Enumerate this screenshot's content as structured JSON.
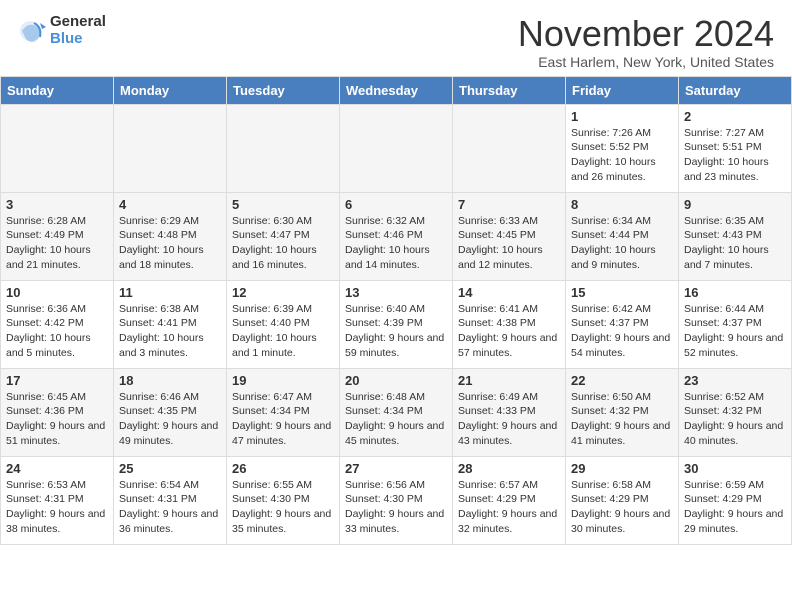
{
  "logo": {
    "general": "General",
    "blue": "Blue"
  },
  "title": "November 2024",
  "location": "East Harlem, New York, United States",
  "weekdays": [
    "Sunday",
    "Monday",
    "Tuesday",
    "Wednesday",
    "Thursday",
    "Friday",
    "Saturday"
  ],
  "weeks": [
    [
      {
        "day": "",
        "info": ""
      },
      {
        "day": "",
        "info": ""
      },
      {
        "day": "",
        "info": ""
      },
      {
        "day": "",
        "info": ""
      },
      {
        "day": "",
        "info": ""
      },
      {
        "day": "1",
        "info": "Sunrise: 7:26 AM\nSunset: 5:52 PM\nDaylight: 10 hours and 26 minutes."
      },
      {
        "day": "2",
        "info": "Sunrise: 7:27 AM\nSunset: 5:51 PM\nDaylight: 10 hours and 23 minutes."
      }
    ],
    [
      {
        "day": "3",
        "info": "Sunrise: 6:28 AM\nSunset: 4:49 PM\nDaylight: 10 hours and 21 minutes."
      },
      {
        "day": "4",
        "info": "Sunrise: 6:29 AM\nSunset: 4:48 PM\nDaylight: 10 hours and 18 minutes."
      },
      {
        "day": "5",
        "info": "Sunrise: 6:30 AM\nSunset: 4:47 PM\nDaylight: 10 hours and 16 minutes."
      },
      {
        "day": "6",
        "info": "Sunrise: 6:32 AM\nSunset: 4:46 PM\nDaylight: 10 hours and 14 minutes."
      },
      {
        "day": "7",
        "info": "Sunrise: 6:33 AM\nSunset: 4:45 PM\nDaylight: 10 hours and 12 minutes."
      },
      {
        "day": "8",
        "info": "Sunrise: 6:34 AM\nSunset: 4:44 PM\nDaylight: 10 hours and 9 minutes."
      },
      {
        "day": "9",
        "info": "Sunrise: 6:35 AM\nSunset: 4:43 PM\nDaylight: 10 hours and 7 minutes."
      }
    ],
    [
      {
        "day": "10",
        "info": "Sunrise: 6:36 AM\nSunset: 4:42 PM\nDaylight: 10 hours and 5 minutes."
      },
      {
        "day": "11",
        "info": "Sunrise: 6:38 AM\nSunset: 4:41 PM\nDaylight: 10 hours and 3 minutes."
      },
      {
        "day": "12",
        "info": "Sunrise: 6:39 AM\nSunset: 4:40 PM\nDaylight: 10 hours and 1 minute."
      },
      {
        "day": "13",
        "info": "Sunrise: 6:40 AM\nSunset: 4:39 PM\nDaylight: 9 hours and 59 minutes."
      },
      {
        "day": "14",
        "info": "Sunrise: 6:41 AM\nSunset: 4:38 PM\nDaylight: 9 hours and 57 minutes."
      },
      {
        "day": "15",
        "info": "Sunrise: 6:42 AM\nSunset: 4:37 PM\nDaylight: 9 hours and 54 minutes."
      },
      {
        "day": "16",
        "info": "Sunrise: 6:44 AM\nSunset: 4:37 PM\nDaylight: 9 hours and 52 minutes."
      }
    ],
    [
      {
        "day": "17",
        "info": "Sunrise: 6:45 AM\nSunset: 4:36 PM\nDaylight: 9 hours and 51 minutes."
      },
      {
        "day": "18",
        "info": "Sunrise: 6:46 AM\nSunset: 4:35 PM\nDaylight: 9 hours and 49 minutes."
      },
      {
        "day": "19",
        "info": "Sunrise: 6:47 AM\nSunset: 4:34 PM\nDaylight: 9 hours and 47 minutes."
      },
      {
        "day": "20",
        "info": "Sunrise: 6:48 AM\nSunset: 4:34 PM\nDaylight: 9 hours and 45 minutes."
      },
      {
        "day": "21",
        "info": "Sunrise: 6:49 AM\nSunset: 4:33 PM\nDaylight: 9 hours and 43 minutes."
      },
      {
        "day": "22",
        "info": "Sunrise: 6:50 AM\nSunset: 4:32 PM\nDaylight: 9 hours and 41 minutes."
      },
      {
        "day": "23",
        "info": "Sunrise: 6:52 AM\nSunset: 4:32 PM\nDaylight: 9 hours and 40 minutes."
      }
    ],
    [
      {
        "day": "24",
        "info": "Sunrise: 6:53 AM\nSunset: 4:31 PM\nDaylight: 9 hours and 38 minutes."
      },
      {
        "day": "25",
        "info": "Sunrise: 6:54 AM\nSunset: 4:31 PM\nDaylight: 9 hours and 36 minutes."
      },
      {
        "day": "26",
        "info": "Sunrise: 6:55 AM\nSunset: 4:30 PM\nDaylight: 9 hours and 35 minutes."
      },
      {
        "day": "27",
        "info": "Sunrise: 6:56 AM\nSunset: 4:30 PM\nDaylight: 9 hours and 33 minutes."
      },
      {
        "day": "28",
        "info": "Sunrise: 6:57 AM\nSunset: 4:29 PM\nDaylight: 9 hours and 32 minutes."
      },
      {
        "day": "29",
        "info": "Sunrise: 6:58 AM\nSunset: 4:29 PM\nDaylight: 9 hours and 30 minutes."
      },
      {
        "day": "30",
        "info": "Sunrise: 6:59 AM\nSunset: 4:29 PM\nDaylight: 9 hours and 29 minutes."
      }
    ]
  ]
}
